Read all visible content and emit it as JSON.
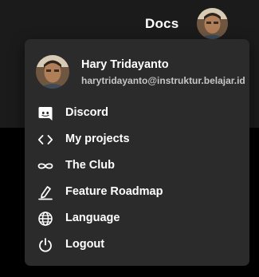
{
  "header": {
    "docs_label": "Docs",
    "avatar_icon": "user-avatar-photo"
  },
  "menu": {
    "profile": {
      "name": "Hary Tridayanto",
      "email": "harytridayanto@instruktur.belajar.id"
    },
    "items": [
      {
        "label": "Discord",
        "icon": "discord-icon"
      },
      {
        "label": "My projects",
        "icon": "code-brackets-icon"
      },
      {
        "label": "The Club",
        "icon": "infinity-icon"
      },
      {
        "label": "Feature Roadmap",
        "icon": "edit-roadmap-icon"
      },
      {
        "label": "Language",
        "icon": "globe-icon"
      },
      {
        "label": "Logout",
        "icon": "power-icon"
      }
    ]
  },
  "colors": {
    "background": "#000000",
    "top_bar": "#1b1b1b",
    "menu_background": "#2b2b2b",
    "text_primary": "#ffffff",
    "text_secondary": "#c6c6c6"
  }
}
